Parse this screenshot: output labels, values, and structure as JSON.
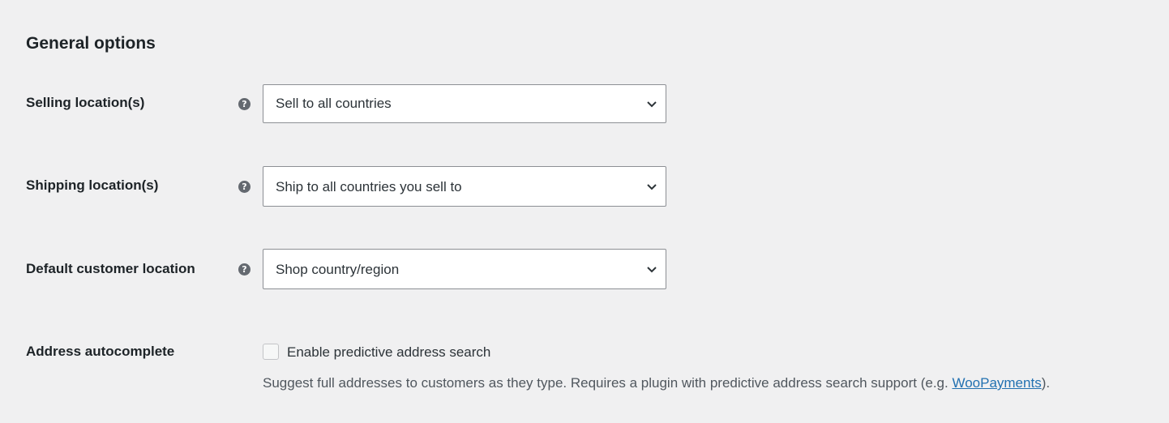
{
  "section": {
    "title": "General options"
  },
  "fields": {
    "selling": {
      "label": "Selling location(s)",
      "help_icon": "help-circle-icon",
      "value": "Sell to all countries"
    },
    "shipping": {
      "label": "Shipping location(s)",
      "help_icon": "help-circle-icon",
      "value": "Ship to all countries you sell to"
    },
    "default_location": {
      "label": "Default customer location",
      "help_icon": "help-circle-icon",
      "value": "Shop country/region"
    },
    "address_autocomplete": {
      "label": "Address autocomplete",
      "checkbox_label": "Enable predictive address search",
      "checked": false,
      "description_before": "Suggest full addresses to customers as they type. Requires a plugin with predictive address search support (e.g. ",
      "description_link": "WooPayments",
      "description_after": ")."
    }
  },
  "colors": {
    "background": "#f0f0f1",
    "text": "#1d2327",
    "link": "#2271b1",
    "border": "#8c8f94",
    "help_icon": "#646970"
  }
}
